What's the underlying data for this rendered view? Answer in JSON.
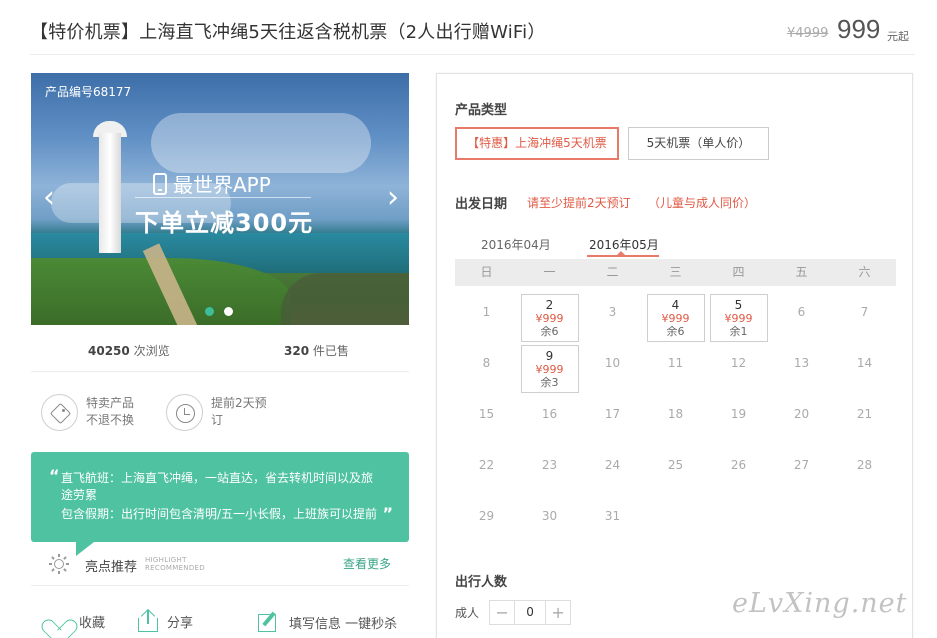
{
  "header": {
    "title": "【特价机票】上海直飞冲绳5天往返含税机票（2人出行赠WiFi）",
    "original_price": "¥4999",
    "price": "999",
    "price_unit": "元起"
  },
  "banner": {
    "product_code": "产品编号68177",
    "app_text": "最世界APP",
    "promo_text": "下单立减300元",
    "prev_arrow": "‹",
    "next_arrow": "›"
  },
  "stats": {
    "views_num": "40250",
    "views_label": "次浏览",
    "sold_num": "320",
    "sold_label": "件已售"
  },
  "features": [
    {
      "line1": "特卖产品",
      "line2": "不退不换"
    },
    {
      "line1": "提前2天预",
      "line2": "订"
    }
  ],
  "highlight": {
    "line1": "直飞航班：上海直飞冲绳，一站直达，省去转机时间以及旅",
    "line2": "途劳累",
    "line3": "包含假期：出行时间包含清明/五一小长假，上班族可以提前"
  },
  "recommend": {
    "label": "亮点推荐",
    "en1": "HIGHLIGHT",
    "en2": "RECOMMENDED",
    "more": "查看更多"
  },
  "actions": {
    "favorite": "收藏",
    "share": "分享",
    "fill": "填写信息 一键秒杀"
  },
  "product_type": {
    "label": "产品类型",
    "options": [
      "【特惠】上海冲绳5天机票",
      "5天机票（单人价）"
    ]
  },
  "date": {
    "label": "出发日期",
    "note1": "请至少提前2天预订",
    "note2": "（儿童与成人同价）",
    "months": [
      "2016年04月",
      "2016年05月"
    ],
    "weekdays": [
      "日",
      "一",
      "二",
      "三",
      "四",
      "五",
      "六"
    ],
    "days": [
      {
        "d": "1",
        "price": "",
        "left": ""
      },
      {
        "d": "2",
        "price": "¥999",
        "left": "余6"
      },
      {
        "d": "3",
        "price": "",
        "left": ""
      },
      {
        "d": "4",
        "price": "¥999",
        "left": "余6"
      },
      {
        "d": "5",
        "price": "¥999",
        "left": "余1"
      },
      {
        "d": "6",
        "price": "",
        "left": ""
      },
      {
        "d": "7",
        "price": "",
        "left": ""
      },
      {
        "d": "8",
        "price": "",
        "left": ""
      },
      {
        "d": "9",
        "price": "¥999",
        "left": "余3"
      },
      {
        "d": "10",
        "price": "",
        "left": ""
      },
      {
        "d": "11",
        "price": "",
        "left": ""
      },
      {
        "d": "12",
        "price": "",
        "left": ""
      },
      {
        "d": "13",
        "price": "",
        "left": ""
      },
      {
        "d": "14",
        "price": "",
        "left": ""
      },
      {
        "d": "15",
        "price": "",
        "left": ""
      },
      {
        "d": "16",
        "price": "",
        "left": ""
      },
      {
        "d": "17",
        "price": "",
        "left": ""
      },
      {
        "d": "18",
        "price": "",
        "left": ""
      },
      {
        "d": "19",
        "price": "",
        "left": ""
      },
      {
        "d": "20",
        "price": "",
        "left": ""
      },
      {
        "d": "21",
        "price": "",
        "left": ""
      },
      {
        "d": "22",
        "price": "",
        "left": ""
      },
      {
        "d": "23",
        "price": "",
        "left": ""
      },
      {
        "d": "24",
        "price": "",
        "left": ""
      },
      {
        "d": "25",
        "price": "",
        "left": ""
      },
      {
        "d": "26",
        "price": "",
        "left": ""
      },
      {
        "d": "27",
        "price": "",
        "left": ""
      },
      {
        "d": "28",
        "price": "",
        "left": ""
      },
      {
        "d": "29",
        "price": "",
        "left": ""
      },
      {
        "d": "30",
        "price": "",
        "left": ""
      },
      {
        "d": "31",
        "price": "",
        "left": ""
      }
    ]
  },
  "people": {
    "label": "出行人数",
    "adult_label": "成人",
    "minus": "−",
    "value": "0",
    "plus": "+"
  },
  "watermark": "eLvXing.net",
  "colors": {
    "accent_green": "#4fc3a1",
    "accent_red": "#e05a45"
  }
}
